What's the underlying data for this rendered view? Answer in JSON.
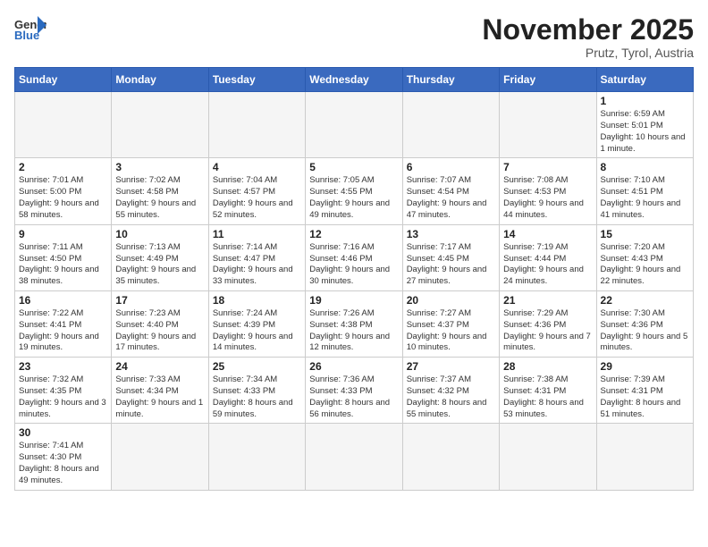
{
  "header": {
    "logo_general": "General",
    "logo_blue": "Blue",
    "month_title": "November 2025",
    "subtitle": "Prutz, Tyrol, Austria"
  },
  "days_of_week": [
    "Sunday",
    "Monday",
    "Tuesday",
    "Wednesday",
    "Thursday",
    "Friday",
    "Saturday"
  ],
  "weeks": [
    [
      {
        "day": "",
        "info": ""
      },
      {
        "day": "",
        "info": ""
      },
      {
        "day": "",
        "info": ""
      },
      {
        "day": "",
        "info": ""
      },
      {
        "day": "",
        "info": ""
      },
      {
        "day": "",
        "info": ""
      },
      {
        "day": "1",
        "info": "Sunrise: 6:59 AM\nSunset: 5:01 PM\nDaylight: 10 hours\nand 1 minute."
      }
    ],
    [
      {
        "day": "2",
        "info": "Sunrise: 7:01 AM\nSunset: 5:00 PM\nDaylight: 9 hours\nand 58 minutes."
      },
      {
        "day": "3",
        "info": "Sunrise: 7:02 AM\nSunset: 4:58 PM\nDaylight: 9 hours\nand 55 minutes."
      },
      {
        "day": "4",
        "info": "Sunrise: 7:04 AM\nSunset: 4:57 PM\nDaylight: 9 hours\nand 52 minutes."
      },
      {
        "day": "5",
        "info": "Sunrise: 7:05 AM\nSunset: 4:55 PM\nDaylight: 9 hours\nand 49 minutes."
      },
      {
        "day": "6",
        "info": "Sunrise: 7:07 AM\nSunset: 4:54 PM\nDaylight: 9 hours\nand 47 minutes."
      },
      {
        "day": "7",
        "info": "Sunrise: 7:08 AM\nSunset: 4:53 PM\nDaylight: 9 hours\nand 44 minutes."
      },
      {
        "day": "8",
        "info": "Sunrise: 7:10 AM\nSunset: 4:51 PM\nDaylight: 9 hours\nand 41 minutes."
      }
    ],
    [
      {
        "day": "9",
        "info": "Sunrise: 7:11 AM\nSunset: 4:50 PM\nDaylight: 9 hours\nand 38 minutes."
      },
      {
        "day": "10",
        "info": "Sunrise: 7:13 AM\nSunset: 4:49 PM\nDaylight: 9 hours\nand 35 minutes."
      },
      {
        "day": "11",
        "info": "Sunrise: 7:14 AM\nSunset: 4:47 PM\nDaylight: 9 hours\nand 33 minutes."
      },
      {
        "day": "12",
        "info": "Sunrise: 7:16 AM\nSunset: 4:46 PM\nDaylight: 9 hours\nand 30 minutes."
      },
      {
        "day": "13",
        "info": "Sunrise: 7:17 AM\nSunset: 4:45 PM\nDaylight: 9 hours\nand 27 minutes."
      },
      {
        "day": "14",
        "info": "Sunrise: 7:19 AM\nSunset: 4:44 PM\nDaylight: 9 hours\nand 24 minutes."
      },
      {
        "day": "15",
        "info": "Sunrise: 7:20 AM\nSunset: 4:43 PM\nDaylight: 9 hours\nand 22 minutes."
      }
    ],
    [
      {
        "day": "16",
        "info": "Sunrise: 7:22 AM\nSunset: 4:41 PM\nDaylight: 9 hours\nand 19 minutes."
      },
      {
        "day": "17",
        "info": "Sunrise: 7:23 AM\nSunset: 4:40 PM\nDaylight: 9 hours\nand 17 minutes."
      },
      {
        "day": "18",
        "info": "Sunrise: 7:24 AM\nSunset: 4:39 PM\nDaylight: 9 hours\nand 14 minutes."
      },
      {
        "day": "19",
        "info": "Sunrise: 7:26 AM\nSunset: 4:38 PM\nDaylight: 9 hours\nand 12 minutes."
      },
      {
        "day": "20",
        "info": "Sunrise: 7:27 AM\nSunset: 4:37 PM\nDaylight: 9 hours\nand 10 minutes."
      },
      {
        "day": "21",
        "info": "Sunrise: 7:29 AM\nSunset: 4:36 PM\nDaylight: 9 hours\nand 7 minutes."
      },
      {
        "day": "22",
        "info": "Sunrise: 7:30 AM\nSunset: 4:36 PM\nDaylight: 9 hours\nand 5 minutes."
      }
    ],
    [
      {
        "day": "23",
        "info": "Sunrise: 7:32 AM\nSunset: 4:35 PM\nDaylight: 9 hours\nand 3 minutes."
      },
      {
        "day": "24",
        "info": "Sunrise: 7:33 AM\nSunset: 4:34 PM\nDaylight: 9 hours\nand 1 minute."
      },
      {
        "day": "25",
        "info": "Sunrise: 7:34 AM\nSunset: 4:33 PM\nDaylight: 8 hours\nand 59 minutes."
      },
      {
        "day": "26",
        "info": "Sunrise: 7:36 AM\nSunset: 4:33 PM\nDaylight: 8 hours\nand 56 minutes."
      },
      {
        "day": "27",
        "info": "Sunrise: 7:37 AM\nSunset: 4:32 PM\nDaylight: 8 hours\nand 55 minutes."
      },
      {
        "day": "28",
        "info": "Sunrise: 7:38 AM\nSunset: 4:31 PM\nDaylight: 8 hours\nand 53 minutes."
      },
      {
        "day": "29",
        "info": "Sunrise: 7:39 AM\nSunset: 4:31 PM\nDaylight: 8 hours\nand 51 minutes."
      }
    ],
    [
      {
        "day": "30",
        "info": "Sunrise: 7:41 AM\nSunset: 4:30 PM\nDaylight: 8 hours\nand 49 minutes."
      },
      {
        "day": "",
        "info": ""
      },
      {
        "day": "",
        "info": ""
      },
      {
        "day": "",
        "info": ""
      },
      {
        "day": "",
        "info": ""
      },
      {
        "day": "",
        "info": ""
      },
      {
        "day": "",
        "info": ""
      }
    ]
  ]
}
